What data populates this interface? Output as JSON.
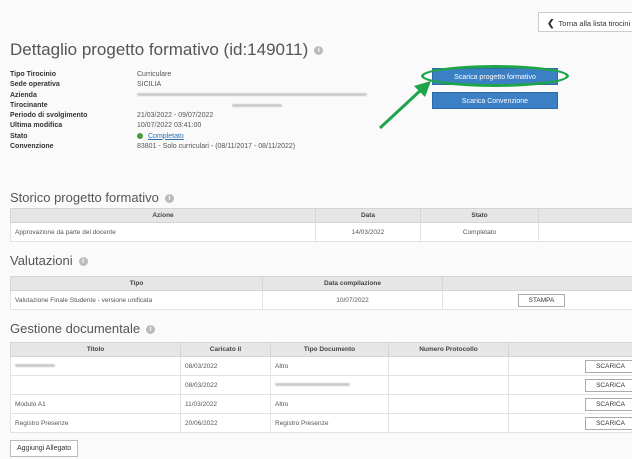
{
  "back_button": {
    "label": "Torna alla lista tirocini"
  },
  "page_title": "Dettaglio progetto formativo (id:149011)",
  "details": [
    {
      "label": "Tipo Tirocinio",
      "value": "Curriculare"
    },
    {
      "label": "Sede operativa",
      "value": "SICILIA"
    },
    {
      "label": "Azienda",
      "value": ""
    },
    {
      "label": "Tirocinante",
      "value": ""
    },
    {
      "label": "Periodo di svolgimento",
      "value": "21/03/2022 - 09/07/2022"
    },
    {
      "label": "Ultima modifica",
      "value": "10/07/2022 03:41:00"
    },
    {
      "label": "Stato",
      "value": "Completato"
    },
    {
      "label": "Convenzione",
      "value": "83801 - Solo curriculari - (08/11/2017 - 08/11/2022)"
    }
  ],
  "actions": {
    "download_project": "Scarica progetto formativo",
    "download_convention": "Scarica Convenzione"
  },
  "colors": {
    "primary": "#3b7fc4",
    "highlight": "#1ea54a",
    "status_ok": "#4a9b3a"
  },
  "storico": {
    "title": "Storico progetto formativo",
    "headers": [
      "Azione",
      "Data",
      "Stato"
    ],
    "rows": [
      {
        "azione": "Approvazione da parte del docente",
        "data": "14/03/2022",
        "stato": "Completato"
      }
    ]
  },
  "valutazioni": {
    "title": "Valutazioni",
    "headers": [
      "Tipo",
      "Data compilazione"
    ],
    "rows": [
      {
        "tipo": "Valutazione Finale Studente - versione unificata",
        "data": "10/07/2022",
        "action": "STAMPA"
      }
    ]
  },
  "documenti": {
    "title": "Gestione documentale",
    "headers": [
      "Titolo",
      "Caricato il",
      "Tipo Documento",
      "Numero Protocollo"
    ],
    "rows": [
      {
        "titolo": "",
        "caricato": "08/03/2022",
        "tipo": "Altro",
        "protocollo": "",
        "action": "SCARICA"
      },
      {
        "titolo": "",
        "caricato": "08/03/2022",
        "tipo": "",
        "protocollo": "",
        "action": "SCARICA"
      },
      {
        "titolo": "Modulo A1",
        "caricato": "11/03/2022",
        "tipo": "Altro",
        "protocollo": "",
        "action": "SCARICA"
      },
      {
        "titolo": "Registro Presenze",
        "caricato": "20/06/2022",
        "tipo": "Registro Presenze",
        "protocollo": "",
        "action": "SCARICA"
      }
    ],
    "add_button": "Aggiungi Allegato"
  }
}
